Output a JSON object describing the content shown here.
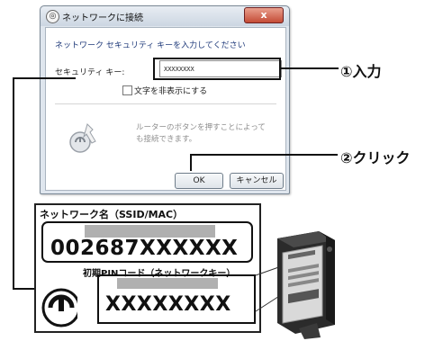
{
  "dialog": {
    "title": "ネットワークに接続",
    "close_label": "x",
    "prompt": "ネットワーク セキュリティ キーを入力してください",
    "key_label": "セキュリティ キー:",
    "key_value": "XXXXXXXX",
    "hide_chars_label": "文字を非表示にする",
    "hide_chars_checked": false,
    "router_hint_line1": "ルーターのボタンを押すことによって",
    "router_hint_line2": "も接続できます。",
    "ok_label": "OK",
    "cancel_label": "キャンセル"
  },
  "callouts": {
    "step1": "①入力",
    "step2": "②クリック"
  },
  "label_card": {
    "title": "ネットワーク名（SSID/MAC）",
    "ssid_value": "002687XXXXXX",
    "pin_label": "初期PINコード（ネットワークキー）",
    "pin_value": "XXXXXXXX"
  },
  "colors": {
    "prompt_text": "#1f3a7a",
    "close_button": "#c44b36",
    "redaction_bar": "#b0b0b0"
  }
}
